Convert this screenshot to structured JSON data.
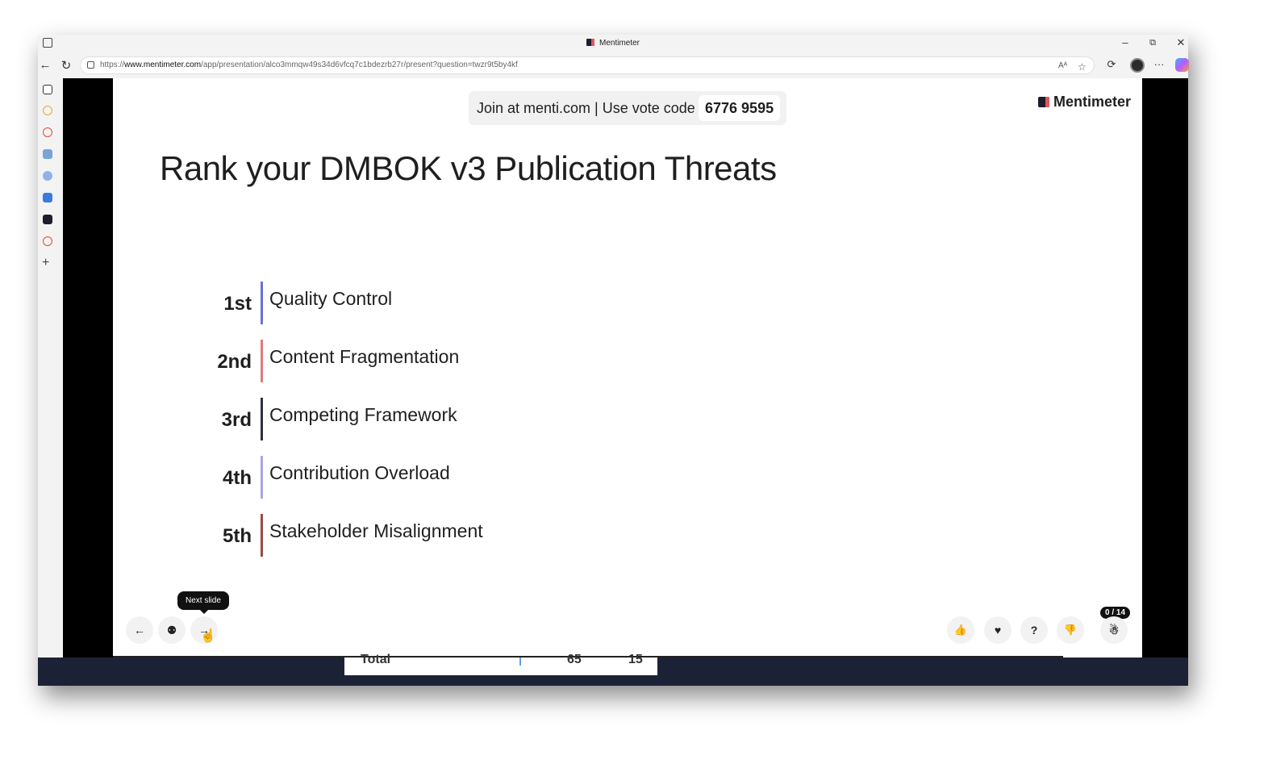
{
  "browser": {
    "tab_title": "Mentimeter",
    "url_prefix": "https://",
    "url_domain": "www.mentimeter.com",
    "url_path": "/app/presentation/alco3mmqw49s34d6vfcq7c1bdezrb27r/present?question=twzr9t5by4kf",
    "read_aloud": "Aᴬ",
    "minimize": "–",
    "restore": "⧉",
    "close": "✕",
    "back": "←",
    "reload": "↻",
    "more": "···",
    "sidebar_add": "+"
  },
  "slide": {
    "join_text": "Join at menti.com | Use vote code",
    "vote_code": "6776 9595",
    "brand": "Mentimeter",
    "title": "Rank your DMBOK v3 Publication Threats",
    "ranks": [
      {
        "rank": "1st",
        "label": "Quality Control",
        "color": "#6b6fd6"
      },
      {
        "rank": "2nd",
        "label": "Content Fragmentation",
        "color": "#e07b7b"
      },
      {
        "rank": "3rd",
        "label": "Competing Framework",
        "color": "#2d2f45"
      },
      {
        "rank": "4th",
        "label": "Contribution Overload",
        "color": "#a9a4e6"
      },
      {
        "rank": "5th",
        "label": "Stakeholder Misalignment",
        "color": "#9c4a42"
      }
    ]
  },
  "controls": {
    "prev": "←",
    "hint": "⚉",
    "next": "→",
    "tooltip": "Next slide",
    "thumbs_up": "👍",
    "heart": "♥",
    "question": "?",
    "thumbs_down": "👎",
    "participants": "☃",
    "participant_count": "0 / 14"
  },
  "behind": {
    "total": "Total",
    "val1": "65",
    "val2": "15"
  }
}
